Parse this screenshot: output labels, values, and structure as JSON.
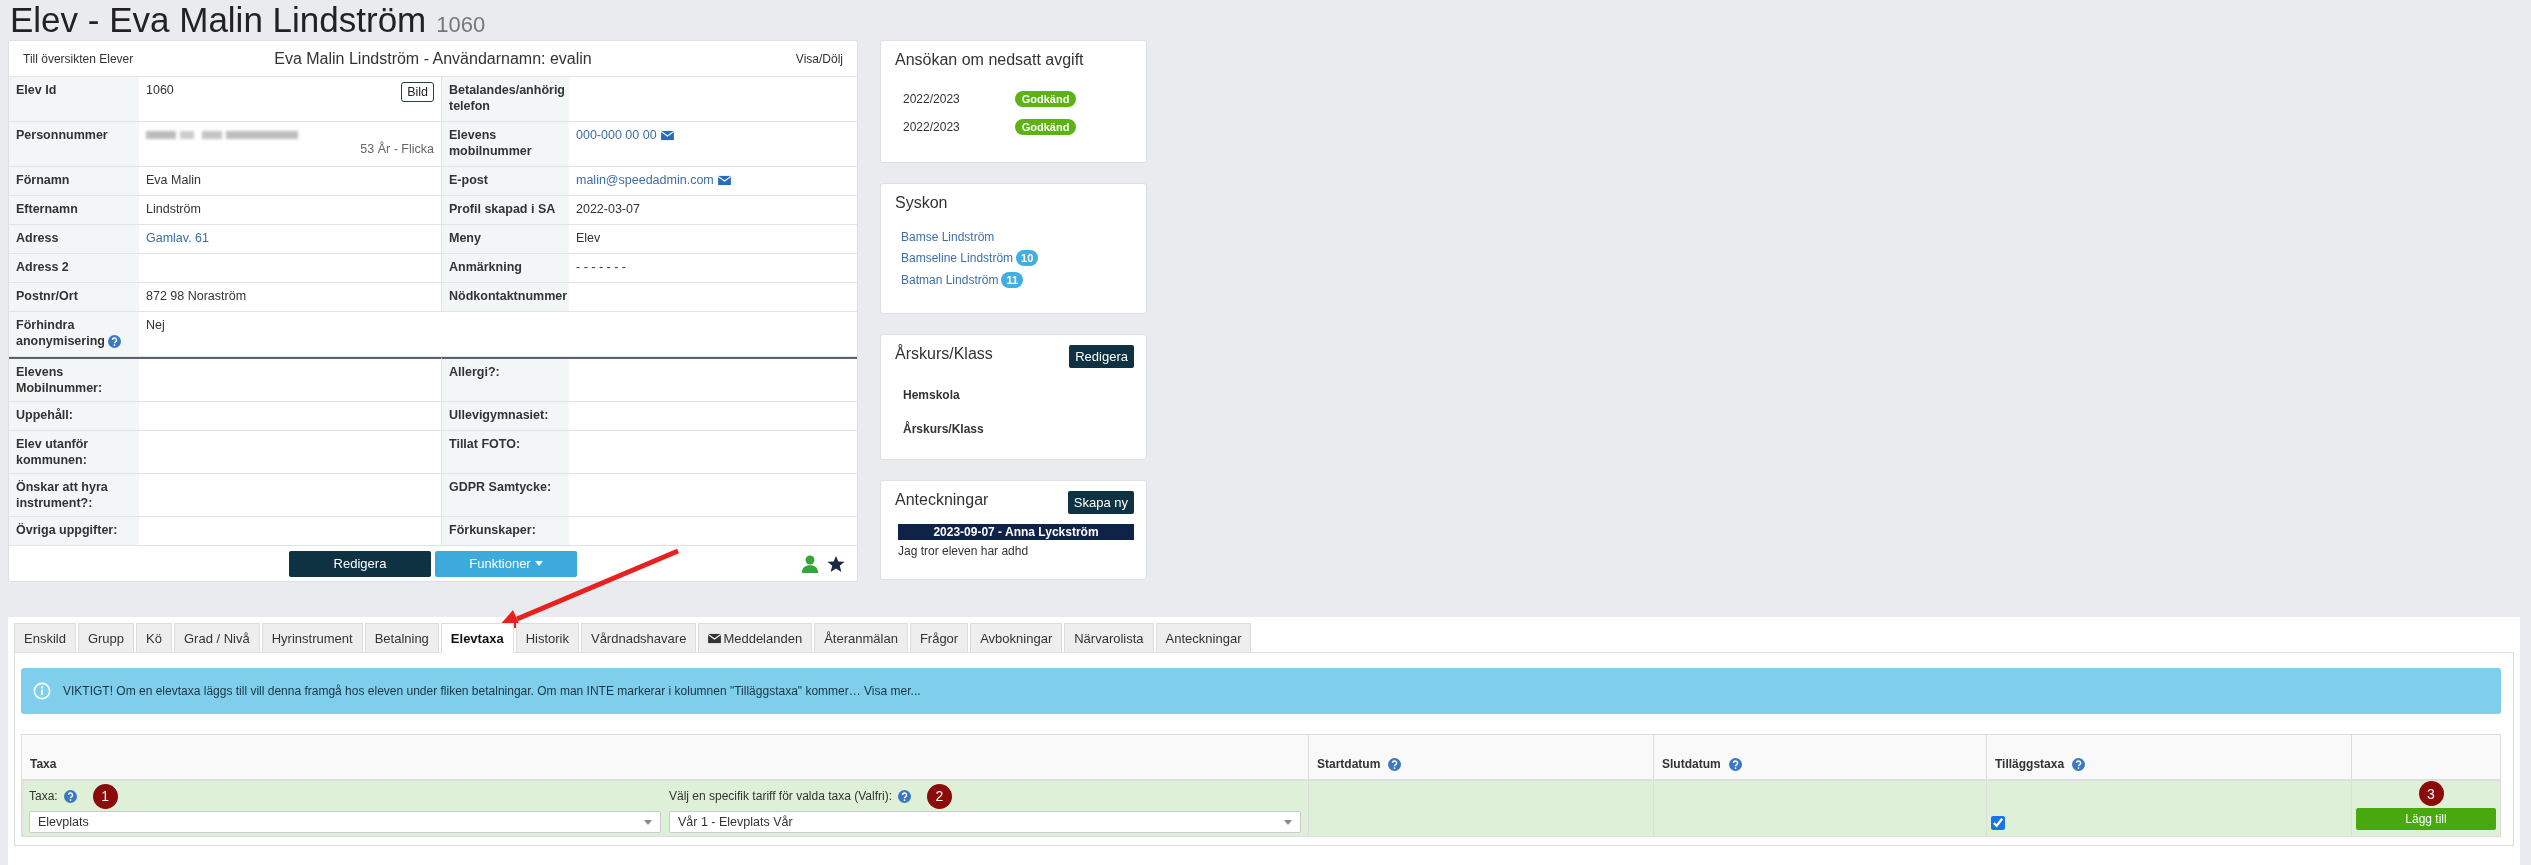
{
  "page_title": {
    "name": "Elev - Eva Malin Lindström",
    "id": "1060"
  },
  "student_card": {
    "back_link": "Till översikten Elever",
    "heading": "Eva Malin Lindström - Användarnamn: evalin",
    "toggle": "Visa/Dölj",
    "rows": [
      {
        "left": {
          "label": "Elev Id",
          "value": "1060",
          "button": "Bild"
        },
        "right": {
          "label": "Betalandes/anhörig telefon"
        }
      },
      {
        "left": {
          "label": "Personnummer",
          "redacted": true,
          "note": "53 År - Flicka"
        },
        "right": {
          "label": "Elevens mobilnummer",
          "value": "000-000 00 00",
          "link": true,
          "mail": true
        }
      },
      {
        "left": {
          "label": "Förnamn",
          "value": "Eva Malin"
        },
        "right": {
          "label": "E-post",
          "value": "malin@speedadmin.com",
          "link": true,
          "mail": true
        }
      },
      {
        "left": {
          "label": "Efternamn",
          "value": "Lindström"
        },
        "right": {
          "label": "Profil skapad i SA",
          "value": "2022-03-07"
        }
      },
      {
        "left": {
          "label": "Adress",
          "value": "Gamlav. 61",
          "link": true
        },
        "right": {
          "label": "Meny",
          "value": "Elev"
        }
      },
      {
        "left": {
          "label": "Adress 2"
        },
        "right": {
          "label": "Anmärkning",
          "value": "- - - - - - -"
        }
      },
      {
        "left": {
          "label": "Postnr/Ort",
          "value": "872 98 Noraström"
        },
        "right": {
          "label": "Nödkontaktnummer"
        }
      }
    ],
    "wide_row": {
      "label": "Förhindra anonymisering",
      "help": true,
      "value": "Nej"
    },
    "extra_rows": [
      {
        "left": "Elevens Mobilnummer:",
        "right": "Allergi?:"
      },
      {
        "left": "Uppehåll:",
        "right": "Ullevigymnasiet:"
      },
      {
        "left": "Elev utanför kommunen:",
        "right": "Tillat FOTO:"
      },
      {
        "left": "Önskar att hyra instrument?:",
        "right": "GDPR Samtycke:"
      },
      {
        "left": "Övriga uppgifter:",
        "right": "Förkunskaper:"
      }
    ],
    "buttons": {
      "edit": "Redigera",
      "functions": "Funktioner"
    }
  },
  "side_panels": [
    {
      "kind": "fees",
      "title": "Ansökan om nedsatt avgift",
      "items": [
        {
          "year": "2022/2023",
          "status": "Godkänd"
        },
        {
          "year": "2022/2023",
          "status": "Godkänd"
        }
      ]
    },
    {
      "kind": "siblings",
      "title": "Syskon",
      "items": [
        {
          "name": "Bamse Lindström"
        },
        {
          "name": "Bamseline Lindström",
          "badge": "10"
        },
        {
          "name": "Batman Lindström",
          "badge": "11"
        }
      ]
    },
    {
      "kind": "class",
      "title": "Årskurs/Klass",
      "button": "Redigera",
      "fields": [
        "Hemskola",
        "Årskurs/Klass"
      ]
    },
    {
      "kind": "notes",
      "title": "Anteckningar",
      "button": "Skapa ny",
      "items": [
        {
          "header": "2023-09-07 - Anna Lyckström",
          "text": "Jag tror eleven har adhd"
        }
      ]
    }
  ],
  "tabs": [
    {
      "label": "Enskild",
      "selected": false,
      "mail_icon": false
    },
    {
      "label": "Grupp",
      "selected": false,
      "mail_icon": false
    },
    {
      "label": "Kö",
      "selected": false,
      "mail_icon": false
    },
    {
      "label": "Grad / Nivå",
      "selected": false,
      "mail_icon": false
    },
    {
      "label": "Hyrinstrument",
      "selected": false,
      "mail_icon": false
    },
    {
      "label": "Betalning",
      "selected": false,
      "mail_icon": false
    },
    {
      "label": "Elevtaxa",
      "selected": true,
      "mail_icon": false
    },
    {
      "label": "Historik",
      "selected": false,
      "mail_icon": false
    },
    {
      "label": "Vårdnadshavare",
      "selected": false,
      "mail_icon": false
    },
    {
      "label": "Meddelanden",
      "selected": false,
      "mail_icon": true
    },
    {
      "label": "Återanmälan",
      "selected": false,
      "mail_icon": false
    },
    {
      "label": "Frågor",
      "selected": false,
      "mail_icon": false
    },
    {
      "label": "Avbokningar",
      "selected": false,
      "mail_icon": false
    },
    {
      "label": "Närvarolista",
      "selected": false,
      "mail_icon": false
    },
    {
      "label": "Anteckningar",
      "selected": false,
      "mail_icon": false
    }
  ],
  "info": {
    "text": "VIKTIGT! Om en elevtaxa läggs till vill denna framgå hos eleven under fliken betalningar. Om man INTE markerar i kolumnen \"Tilläggstaxa\" kommer…",
    "link": "Visa mer..."
  },
  "table": {
    "columns": [
      {
        "label": "Taxa",
        "help": false
      },
      {
        "label": "Startdatum",
        "help": true
      },
      {
        "label": "Slutdatum",
        "help": true
      },
      {
        "label": "Tilläggstaxa",
        "help": true
      },
      {
        "help": false
      }
    ],
    "row": {
      "fields": [
        {
          "label": "Taxa:",
          "help": true,
          "step": "1",
          "value": "Elevplats"
        },
        {
          "label": "Välj en specifik tariff för valda taxa (Valfri):",
          "help": true,
          "step": "2",
          "value": "Vår 1 - Elevplats Vår"
        }
      ],
      "addon_checked": true,
      "button": "Lägg till",
      "button_step": "3"
    }
  }
}
